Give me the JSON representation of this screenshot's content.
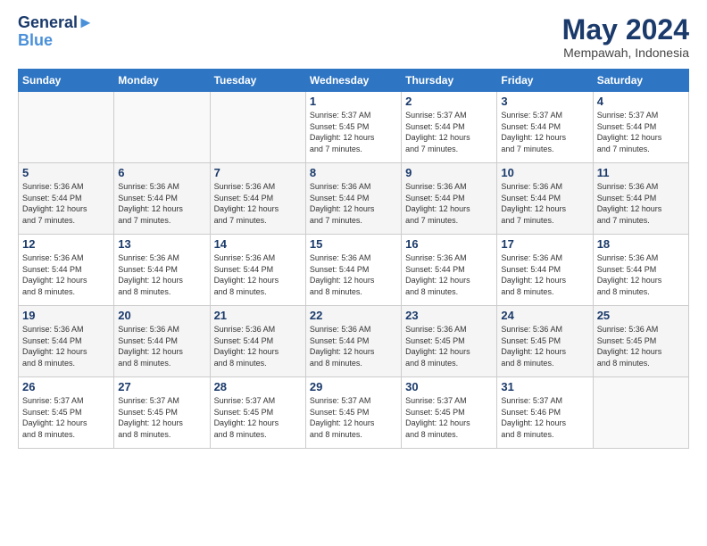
{
  "header": {
    "logo_line1": "General",
    "logo_line2": "Blue",
    "month": "May 2024",
    "location": "Mempawah, Indonesia"
  },
  "weekdays": [
    "Sunday",
    "Monday",
    "Tuesday",
    "Wednesday",
    "Thursday",
    "Friday",
    "Saturday"
  ],
  "weeks": [
    [
      {
        "day": "",
        "info": ""
      },
      {
        "day": "",
        "info": ""
      },
      {
        "day": "",
        "info": ""
      },
      {
        "day": "1",
        "info": "Sunrise: 5:37 AM\nSunset: 5:45 PM\nDaylight: 12 hours\nand 7 minutes."
      },
      {
        "day": "2",
        "info": "Sunrise: 5:37 AM\nSunset: 5:44 PM\nDaylight: 12 hours\nand 7 minutes."
      },
      {
        "day": "3",
        "info": "Sunrise: 5:37 AM\nSunset: 5:44 PM\nDaylight: 12 hours\nand 7 minutes."
      },
      {
        "day": "4",
        "info": "Sunrise: 5:37 AM\nSunset: 5:44 PM\nDaylight: 12 hours\nand 7 minutes."
      }
    ],
    [
      {
        "day": "5",
        "info": "Sunrise: 5:36 AM\nSunset: 5:44 PM\nDaylight: 12 hours\nand 7 minutes."
      },
      {
        "day": "6",
        "info": "Sunrise: 5:36 AM\nSunset: 5:44 PM\nDaylight: 12 hours\nand 7 minutes."
      },
      {
        "day": "7",
        "info": "Sunrise: 5:36 AM\nSunset: 5:44 PM\nDaylight: 12 hours\nand 7 minutes."
      },
      {
        "day": "8",
        "info": "Sunrise: 5:36 AM\nSunset: 5:44 PM\nDaylight: 12 hours\nand 7 minutes."
      },
      {
        "day": "9",
        "info": "Sunrise: 5:36 AM\nSunset: 5:44 PM\nDaylight: 12 hours\nand 7 minutes."
      },
      {
        "day": "10",
        "info": "Sunrise: 5:36 AM\nSunset: 5:44 PM\nDaylight: 12 hours\nand 7 minutes."
      },
      {
        "day": "11",
        "info": "Sunrise: 5:36 AM\nSunset: 5:44 PM\nDaylight: 12 hours\nand 7 minutes."
      }
    ],
    [
      {
        "day": "12",
        "info": "Sunrise: 5:36 AM\nSunset: 5:44 PM\nDaylight: 12 hours\nand 8 minutes."
      },
      {
        "day": "13",
        "info": "Sunrise: 5:36 AM\nSunset: 5:44 PM\nDaylight: 12 hours\nand 8 minutes."
      },
      {
        "day": "14",
        "info": "Sunrise: 5:36 AM\nSunset: 5:44 PM\nDaylight: 12 hours\nand 8 minutes."
      },
      {
        "day": "15",
        "info": "Sunrise: 5:36 AM\nSunset: 5:44 PM\nDaylight: 12 hours\nand 8 minutes."
      },
      {
        "day": "16",
        "info": "Sunrise: 5:36 AM\nSunset: 5:44 PM\nDaylight: 12 hours\nand 8 minutes."
      },
      {
        "day": "17",
        "info": "Sunrise: 5:36 AM\nSunset: 5:44 PM\nDaylight: 12 hours\nand 8 minutes."
      },
      {
        "day": "18",
        "info": "Sunrise: 5:36 AM\nSunset: 5:44 PM\nDaylight: 12 hours\nand 8 minutes."
      }
    ],
    [
      {
        "day": "19",
        "info": "Sunrise: 5:36 AM\nSunset: 5:44 PM\nDaylight: 12 hours\nand 8 minutes."
      },
      {
        "day": "20",
        "info": "Sunrise: 5:36 AM\nSunset: 5:44 PM\nDaylight: 12 hours\nand 8 minutes."
      },
      {
        "day": "21",
        "info": "Sunrise: 5:36 AM\nSunset: 5:44 PM\nDaylight: 12 hours\nand 8 minutes."
      },
      {
        "day": "22",
        "info": "Sunrise: 5:36 AM\nSunset: 5:44 PM\nDaylight: 12 hours\nand 8 minutes."
      },
      {
        "day": "23",
        "info": "Sunrise: 5:36 AM\nSunset: 5:45 PM\nDaylight: 12 hours\nand 8 minutes."
      },
      {
        "day": "24",
        "info": "Sunrise: 5:36 AM\nSunset: 5:45 PM\nDaylight: 12 hours\nand 8 minutes."
      },
      {
        "day": "25",
        "info": "Sunrise: 5:36 AM\nSunset: 5:45 PM\nDaylight: 12 hours\nand 8 minutes."
      }
    ],
    [
      {
        "day": "26",
        "info": "Sunrise: 5:37 AM\nSunset: 5:45 PM\nDaylight: 12 hours\nand 8 minutes."
      },
      {
        "day": "27",
        "info": "Sunrise: 5:37 AM\nSunset: 5:45 PM\nDaylight: 12 hours\nand 8 minutes."
      },
      {
        "day": "28",
        "info": "Sunrise: 5:37 AM\nSunset: 5:45 PM\nDaylight: 12 hours\nand 8 minutes."
      },
      {
        "day": "29",
        "info": "Sunrise: 5:37 AM\nSunset: 5:45 PM\nDaylight: 12 hours\nand 8 minutes."
      },
      {
        "day": "30",
        "info": "Sunrise: 5:37 AM\nSunset: 5:45 PM\nDaylight: 12 hours\nand 8 minutes."
      },
      {
        "day": "31",
        "info": "Sunrise: 5:37 AM\nSunset: 5:46 PM\nDaylight: 12 hours\nand 8 minutes."
      },
      {
        "day": "",
        "info": ""
      }
    ]
  ]
}
